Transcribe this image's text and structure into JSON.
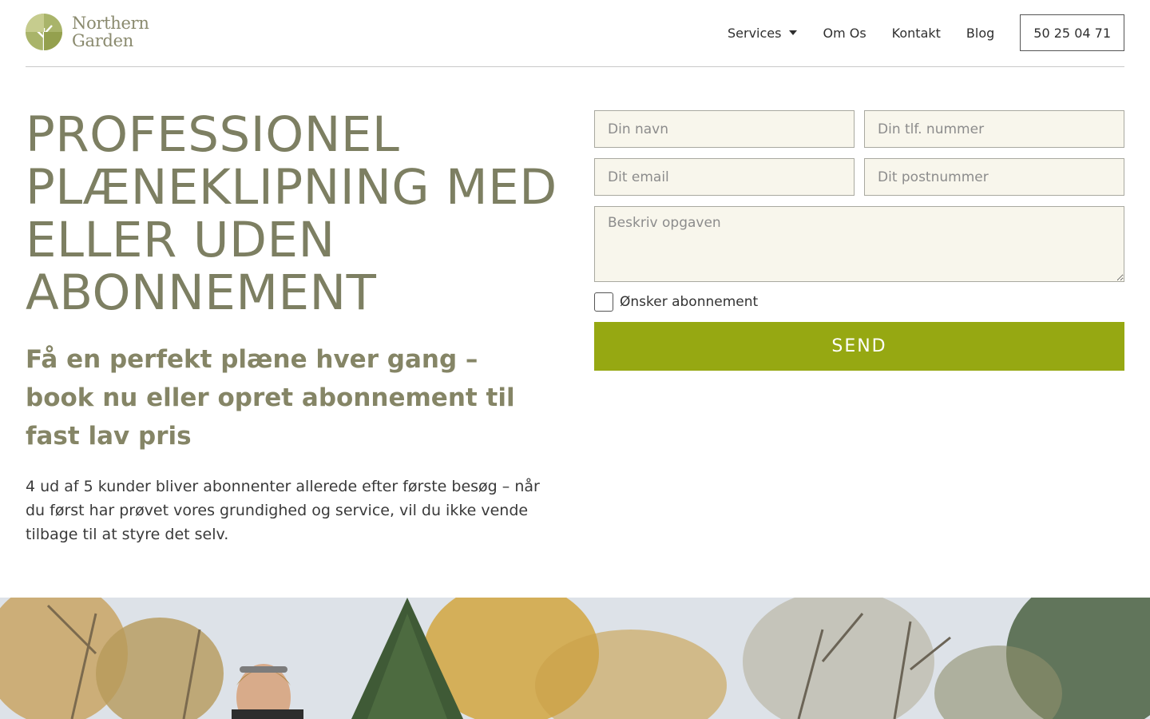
{
  "brand": {
    "line1": "Northern",
    "line2": "Garden"
  },
  "nav": {
    "items": [
      {
        "label": "Services",
        "has_dropdown": true
      },
      {
        "label": "Om Os",
        "has_dropdown": false
      },
      {
        "label": "Kontakt",
        "has_dropdown": false
      },
      {
        "label": "Blog",
        "has_dropdown": false
      }
    ],
    "phone": "50 25 04 71"
  },
  "hero": {
    "title": "PROFESSIONEL PLÆNEKLIPNING MED ELLER UDEN ABONNEMENT",
    "subtitle": "Få en perfekt plæne hver gang – book nu eller opret abonnement til fast lav pris",
    "body": "4 ud af 5 kunder bliver abonnenter allerede efter første besøg – når du først har prøvet vores grundighed og service, vil du ikke vende tilbage til at styre det selv."
  },
  "form": {
    "name_placeholder": "Din navn",
    "phone_placeholder": "Din tlf. nummer",
    "email_placeholder": "Dit email",
    "zip_placeholder": "Dit postnummer",
    "message_placeholder": "Beskriv opgaven",
    "subscription_label": "Ønsker abonnement",
    "subscription_checked": false,
    "submit_label": "SEND"
  },
  "colors": {
    "accent": "#96a812",
    "heading": "#7d7f62",
    "field_bg": "#f8f6ec"
  }
}
